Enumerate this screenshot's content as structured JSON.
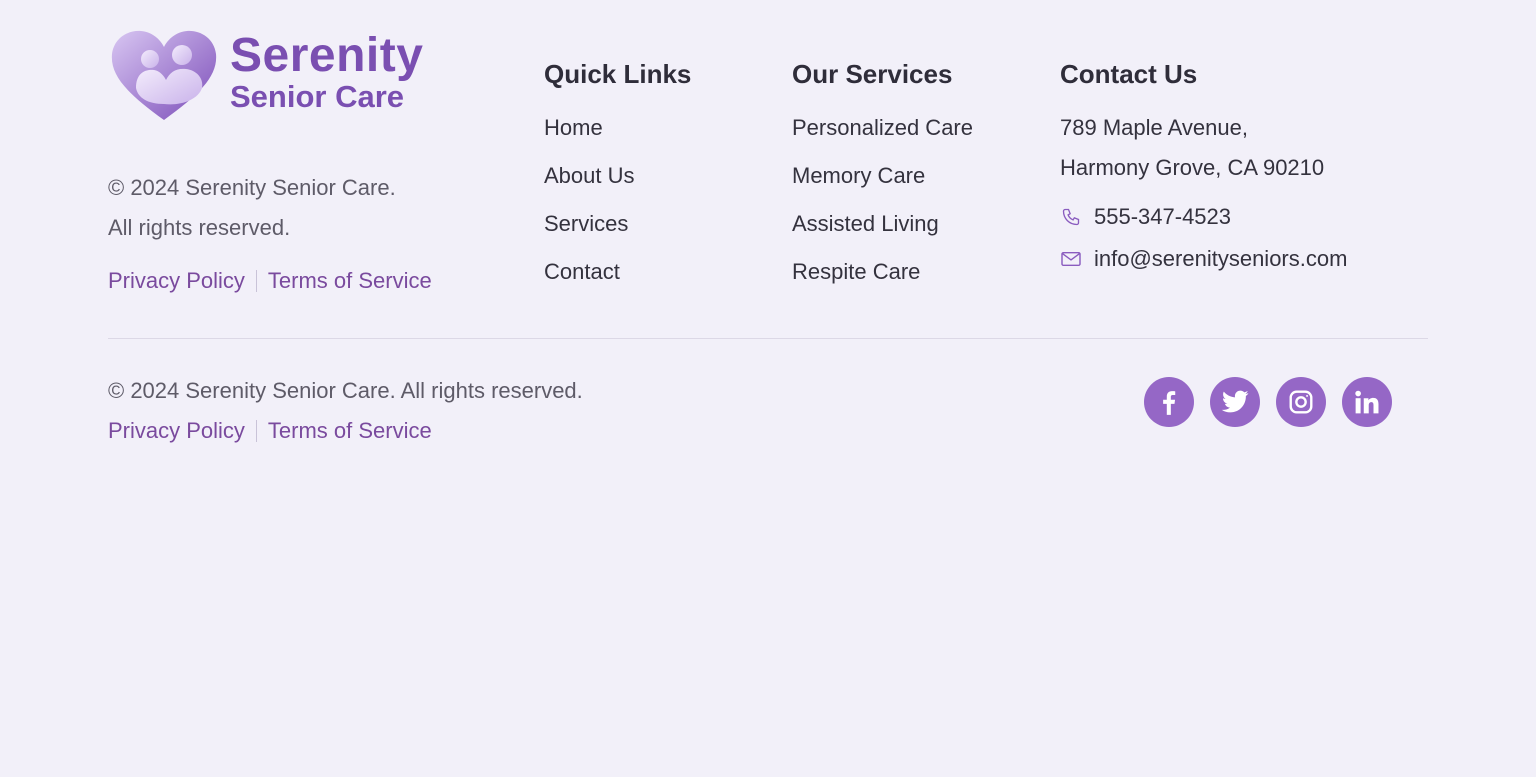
{
  "brand": {
    "name_line1": "Serenity",
    "name_line2": "Senior Care",
    "copyright_line1": "© 2024 Serenity Senior Care.",
    "copyright_line2": "All rights reserved.",
    "privacy": "Privacy Policy",
    "terms": "Terms of Service"
  },
  "quick_links": {
    "title": "Quick Links",
    "items": [
      "Home",
      "About Us",
      "Services",
      "Contact"
    ]
  },
  "services": {
    "title": "Our Services",
    "items": [
      "Personalized Care",
      "Memory Care",
      "Assisted Living",
      "Respite Care"
    ]
  },
  "contact": {
    "title": "Contact Us",
    "address_line1": "789 Maple Avenue,",
    "address_line2": "Harmony Grove, CA 90210",
    "phone": "555-347-4523",
    "email": "info@serenityseniors.com",
    "phone_icon": "phone-icon",
    "email_icon": "mail-icon"
  },
  "bottom": {
    "copyright": "© 2024 Serenity Senior Care. All rights reserved.",
    "privacy": "Privacy Policy",
    "terms": "Terms of Service"
  },
  "social": [
    "facebook-icon",
    "twitter-icon",
    "instagram-icon",
    "linkedin-icon"
  ],
  "colors": {
    "brand": "#7a4fb1",
    "link": "#7a4a9e",
    "social_bg": "#9567c6",
    "background": "#f2f0f9"
  }
}
